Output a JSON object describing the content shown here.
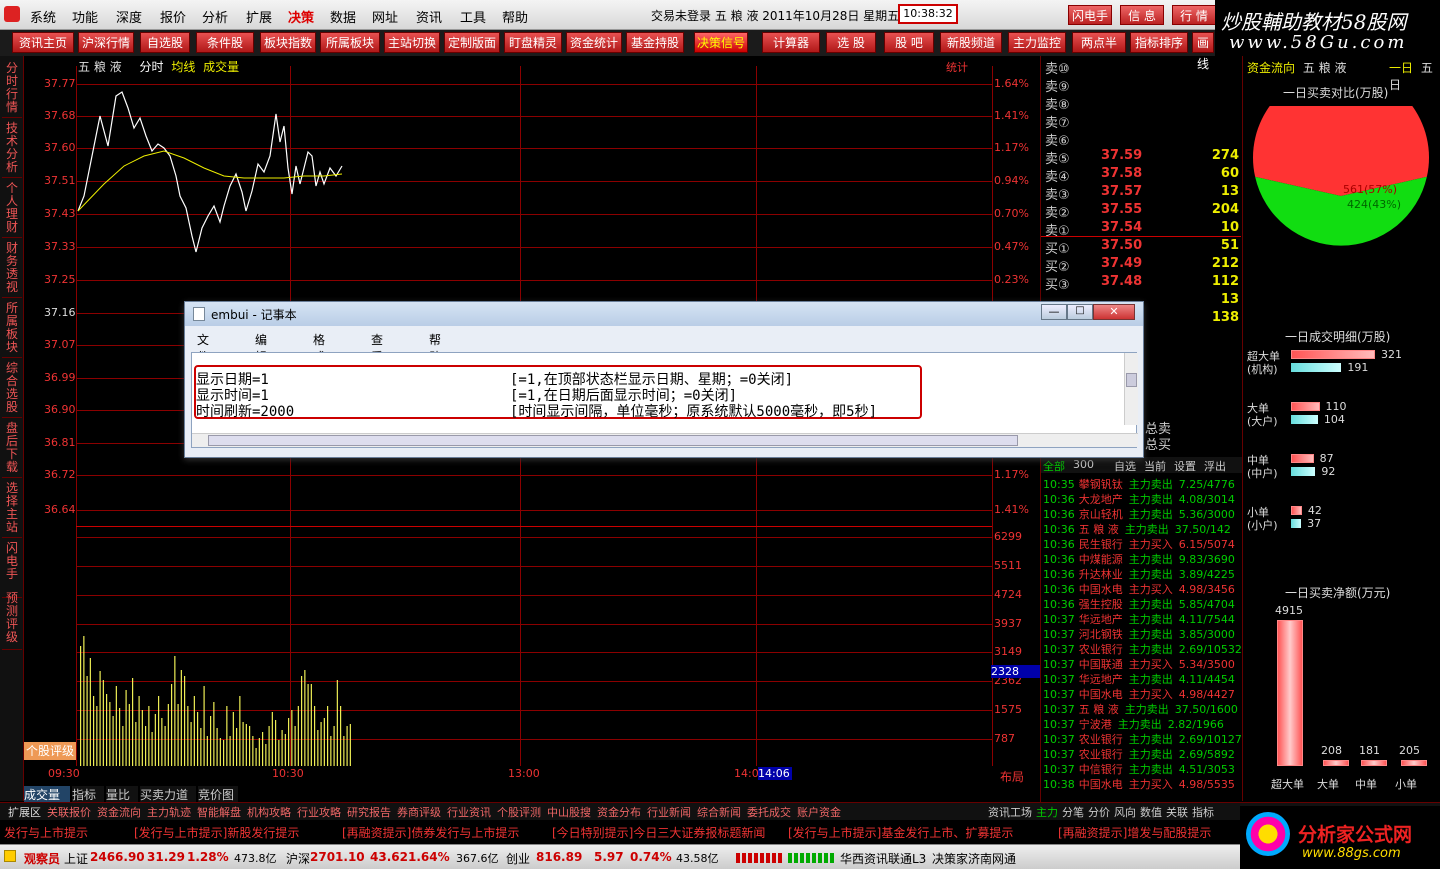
{
  "menubar": {
    "items": [
      "系统",
      "功能",
      "深度",
      "报价",
      "分析",
      "扩展",
      "决策",
      "数据",
      "网址",
      "资讯",
      "工具",
      "帮助"
    ],
    "active_index": 6,
    "status": "交易未登录  五 粮 液  2011年10月28日  星期五",
    "clock": "10:38:32",
    "right_buttons": [
      "闪电手",
      "信 息",
      "行 情"
    ]
  },
  "toolbar": {
    "buttons": [
      "资讯主页",
      "沪深行情",
      "自选股",
      "条件股",
      "板块指数",
      "所属板块",
      "主站切换",
      "定制版面",
      "盯盘精灵",
      "资金统计",
      "基金持股",
      "决策信号",
      "计算器",
      "选 股",
      "股 吧",
      "新股频道",
      "主力监控",
      "两点半",
      "指标排序",
      "画线"
    ],
    "selected_index": 11
  },
  "brand": {
    "line1": "炒股輔助教材58股网",
    "line2": "www.58Gu.com"
  },
  "left_tabs": [
    "分时行情",
    "技术分析",
    "个人理财",
    "财务透视",
    "所属板块",
    "综合选股",
    "盘后下载",
    "选择主站",
    "闪电手",
    "预测评级"
  ],
  "chart": {
    "header": {
      "name": "五 粮 液",
      "mode": "分时",
      "avg": "均线",
      "vol": "成交量",
      "stat": "统计"
    },
    "price_labels": [
      "37.77",
      "37.68",
      "37.60",
      "37.51",
      "37.43",
      "37.33",
      "37.25",
      "37.16",
      "37.07",
      "36.99",
      "36.90",
      "36.81",
      "36.72",
      "36.64"
    ],
    "pct_labels": [
      "1.64%",
      "1.41%",
      "1.17%",
      "0.94%",
      "0.70%",
      "0.47%",
      "0.23%",
      "",
      "",
      "",
      "",
      "",
      "1.17%",
      "1.41%"
    ],
    "vol_labels": [
      "6299",
      "5511",
      "4724",
      "3937",
      "3149",
      "2362",
      "1575",
      "787"
    ],
    "vol_highlight": "2328",
    "time_labels": [
      "09:30",
      "10:30",
      "13:00",
      "14:0"
    ],
    "time_highlight": "14:06",
    "rating_btn": "个股评级",
    "right_label": "布局",
    "bottom_tabs": [
      "成交量",
      "指标",
      "量比",
      "买卖力道",
      "竞价图"
    ]
  },
  "orderbook": {
    "rows": [
      {
        "label": "卖⑩",
        "price": "",
        "vol": ""
      },
      {
        "label": "卖⑨",
        "price": "",
        "vol": ""
      },
      {
        "label": "卖⑧",
        "price": "",
        "vol": ""
      },
      {
        "label": "卖⑦",
        "price": "",
        "vol": ""
      },
      {
        "label": "卖⑥",
        "price": "",
        "vol": ""
      },
      {
        "label": "卖⑤",
        "price": "37.59",
        "vol": "274"
      },
      {
        "label": "卖④",
        "price": "37.58",
        "vol": "60"
      },
      {
        "label": "卖③",
        "price": "37.57",
        "vol": "13"
      },
      {
        "label": "卖②",
        "price": "37.55",
        "vol": "204"
      },
      {
        "label": "卖①",
        "price": "37.54",
        "vol": "10"
      },
      {
        "label": "买①",
        "price": "37.50",
        "vol": "51"
      },
      {
        "label": "买②",
        "price": "37.49",
        "vol": "212"
      },
      {
        "label": "买③",
        "price": "37.48",
        "vol": "112"
      },
      {
        "label": "",
        "price": "",
        "vol": "13"
      },
      {
        "label": "",
        "price": "",
        "vol": "138"
      }
    ],
    "side_labels": [
      "总卖",
      "总买"
    ]
  },
  "ticks": {
    "tabs": [
      "全部",
      "300",
      "自选",
      "当前",
      "设置",
      "浮出"
    ],
    "rows": [
      {
        "t": "10:35",
        "n": "攀钢钒钛",
        "a": "主力卖出",
        "v": "7.25/4776"
      },
      {
        "t": "10:36",
        "n": "大龙地产",
        "a": "主力卖出",
        "v": "4.08/3014"
      },
      {
        "t": "10:36",
        "n": "京山轻机",
        "a": "主力卖出",
        "v": "5.36/3000"
      },
      {
        "t": "10:36",
        "n": "五 粮 液",
        "a": "主力卖出",
        "v": "37.50/142"
      },
      {
        "t": "10:36",
        "n": "民生银行",
        "a": "主力买入",
        "v": "6.15/5074"
      },
      {
        "t": "10:36",
        "n": "中煤能源",
        "a": "主力卖出",
        "v": "9.83/3690"
      },
      {
        "t": "10:36",
        "n": "升达林业",
        "a": "主力卖出",
        "v": "3.89/4225"
      },
      {
        "t": "10:36",
        "n": "中国水电",
        "a": "主力买入",
        "v": "4.98/3456"
      },
      {
        "t": "10:36",
        "n": "强生控股",
        "a": "主力卖出",
        "v": "5.85/4704"
      },
      {
        "t": "10:37",
        "n": "华远地产",
        "a": "主力卖出",
        "v": "4.11/7544"
      },
      {
        "t": "10:37",
        "n": "河北钢铁",
        "a": "主力卖出",
        "v": "3.85/3000"
      },
      {
        "t": "10:37",
        "n": "农业银行",
        "a": "主力卖出",
        "v": "2.69/10532"
      },
      {
        "t": "10:37",
        "n": "中国联通",
        "a": "主力买入",
        "v": "5.34/3500"
      },
      {
        "t": "10:37",
        "n": "华远地产",
        "a": "主力卖出",
        "v": "4.11/4454"
      },
      {
        "t": "10:37",
        "n": "中国水电",
        "a": "主力买入",
        "v": "4.98/4427"
      },
      {
        "t": "10:37",
        "n": "五 粮 液",
        "a": "主力卖出",
        "v": "37.50/1600"
      },
      {
        "t": "10:37",
        "n": "宁波港",
        "a": "主力卖出",
        "v": "2.82/1966"
      },
      {
        "t": "10:37",
        "n": "农业银行",
        "a": "主力卖出",
        "v": "2.69/10127"
      },
      {
        "t": "10:37",
        "n": "农业银行",
        "a": "主力卖出",
        "v": "2.69/5892"
      },
      {
        "t": "10:37",
        "n": "中信银行",
        "a": "主力卖出",
        "v": "4.51/3053"
      },
      {
        "t": "10:38",
        "n": "中国水电",
        "a": "主力买入",
        "v": "4.98/5535"
      }
    ]
  },
  "capital": {
    "tab": "资金流向",
    "stock": "五 粮 液",
    "day1": "一日",
    "day5": "五日",
    "pie_title": "一日买卖对比(万股)",
    "pie_sell": "561(57%)",
    "pie_buy": "424(43%)",
    "pie_sell_frac": 0.57,
    "detail_title": "一日成交明细(万股)",
    "detail": [
      {
        "l1": "超大单",
        "l2": "(机构)",
        "buy": "321",
        "sell": "191",
        "buy_frac": 1.0,
        "sell_frac": 0.6
      },
      {
        "l1": "大单",
        "l2": "(大户)",
        "buy": "110",
        "sell": "104",
        "buy_frac": 0.34,
        "sell_frac": 0.32
      },
      {
        "l1": "中单",
        "l2": "(中户)",
        "buy": "87",
        "sell": "92",
        "buy_frac": 0.27,
        "sell_frac": 0.29
      },
      {
        "l1": "小单",
        "l2": "(小户)",
        "buy": "42",
        "sell": "37",
        "buy_frac": 0.13,
        "sell_frac": 0.12
      }
    ],
    "net_title": "一日买卖净额(万元)",
    "net": [
      {
        "label": "超大单",
        "value": "4915",
        "frac": 1.0
      },
      {
        "label": "大单",
        "value": "208",
        "frac": 0.04
      },
      {
        "label": "中单",
        "value": "181",
        "frac": 0.037
      },
      {
        "label": "小单",
        "value": "205",
        "frac": 0.042
      }
    ]
  },
  "notepad": {
    "title": "embui - 记事本",
    "menu": [
      "文件(F)",
      "编辑(E)",
      "格式(O)",
      "查看(V)",
      "帮助(H)"
    ],
    "lines": [
      {
        "key": "显示日期=1",
        "desc": "[=1,在顶部状态栏显示日期、星期；=0关闭]"
      },
      {
        "key": "显示时间=1",
        "desc": "[=1,在日期后面显示时间；=0关闭]"
      },
      {
        "key": "时间刷新=2000",
        "desc": "[时间显示间隔，单位毫秒；原系统默认5000毫秒，即5秒]"
      }
    ]
  },
  "bottom_tabs": [
    "扩展区",
    "关联报价",
    "资金流向",
    "主力轨迹",
    "智能解盘",
    "机构攻略",
    "行业攻略",
    "研究报告",
    "券商评级",
    "行业资讯",
    "个股评测",
    "中山股搜",
    "资金分布",
    "行业新闻",
    "综合新闻",
    "委托成交",
    "账户资金"
  ],
  "bottom_tabs_right": [
    "资讯工场",
    "主力",
    "分笔",
    "分价",
    "风向",
    "数值",
    "关联",
    "指标"
  ],
  "ticker": [
    "发行与上市提示",
    "[发行与上市提示]新股发行提示",
    "[再融资提示]债券发行与上市提示",
    "[今日特别提示]今日三大证券报标题新闻",
    "[发行与上市提示]基金发行上市、扩募提示",
    "[再融资提示]增发与配股提示"
  ],
  "statusbar": {
    "user": "观察员",
    "sh_name": "上证",
    "sh_val": "2466.90",
    "sh_chg": "31.29",
    "sh_pct": "1.28%",
    "sh_amt": "473.8亿",
    "hs_name": "沪深",
    "hs_val": "2701.10",
    "hs_chg": "43.62",
    "hs_pct": "1.64%",
    "hs_amt": "367.6亿",
    "cy_name": "创业",
    "cy_val": "816.89",
    "cy_chg": "5.97",
    "cy_pct": "0.74%",
    "cy_amt": "43.58亿",
    "server": "华西资讯联通L3",
    "server2": "决策家济南网通"
  },
  "logo2": {
    "line1": "分析家公式网",
    "line2": "www.88gs.com"
  }
}
